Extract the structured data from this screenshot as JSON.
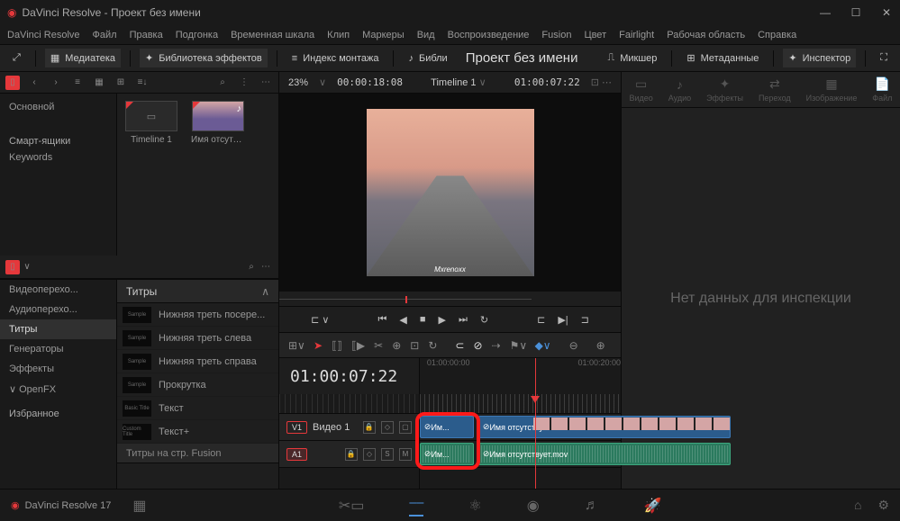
{
  "window": {
    "title": "DaVinci Resolve - Проект без имени"
  },
  "menu": [
    "DaVinci Resolve",
    "Файл",
    "Правка",
    "Подгонка",
    "Временная шкала",
    "Клип",
    "Маркеры",
    "Вид",
    "Воспроизведение",
    "Fusion",
    "Цвет",
    "Fairlight",
    "Рабочая область",
    "Справка"
  ],
  "toolbar": {
    "media_pool": "Медиатека",
    "effects": "Библиотека эффектов",
    "edit_index": "Индекс монтажа",
    "sound_lib": "Библи",
    "project_title": "Проект без имени",
    "mixer": "Микшер",
    "metadata": "Метаданные",
    "inspector": "Инспектор"
  },
  "pool": {
    "bin": "Основной",
    "smart": "Смарт-ящики",
    "keywords": "Keywords",
    "thumbs": [
      {
        "label": "Timeline 1",
        "type": "tl"
      },
      {
        "label": "Имя отсутст...",
        "type": "vid"
      }
    ]
  },
  "effects": {
    "categories": [
      "Видеоперехо...",
      "Аудиоперехо...",
      "Титры",
      "Генераторы",
      "Эффекты",
      "OpenFX"
    ],
    "favorites": "Избранное",
    "section_title": "Титры",
    "items": [
      "Нижняя треть посере...",
      "Нижняя треть слева",
      "Нижняя треть справа",
      "Прокрутка",
      "Текст",
      "Текст+"
    ],
    "thumb_labels": [
      "Sample",
      "Sample",
      "Sample",
      "Sample",
      "Basic Title",
      "Custom Title"
    ],
    "footer": "Титры на стр. Fusion"
  },
  "viewer": {
    "zoom": "23%",
    "tc_left": "00:00:18:08",
    "name": "Timeline 1",
    "tc_right": "01:00:07:22",
    "watermark": "Mxrenoxx"
  },
  "timeline": {
    "timecode": "01:00:07:22",
    "tracks": {
      "v1": {
        "badge": "V1",
        "name": "Видео 1"
      },
      "a1": {
        "badge": "A1"
      }
    },
    "clips": {
      "short_label": "Им...",
      "long_label": "Имя отсутствует.mov"
    },
    "ruler_marks": [
      "01:00:00:00",
      "01:00:20:00"
    ]
  },
  "inspector": {
    "tabs": [
      "Видео",
      "Аудио",
      "Эффекты",
      "Переход",
      "Изображение",
      "Файл"
    ],
    "empty": "Нет данных для инспекции"
  },
  "bottom": {
    "version": "DaVinci Resolve 17"
  }
}
